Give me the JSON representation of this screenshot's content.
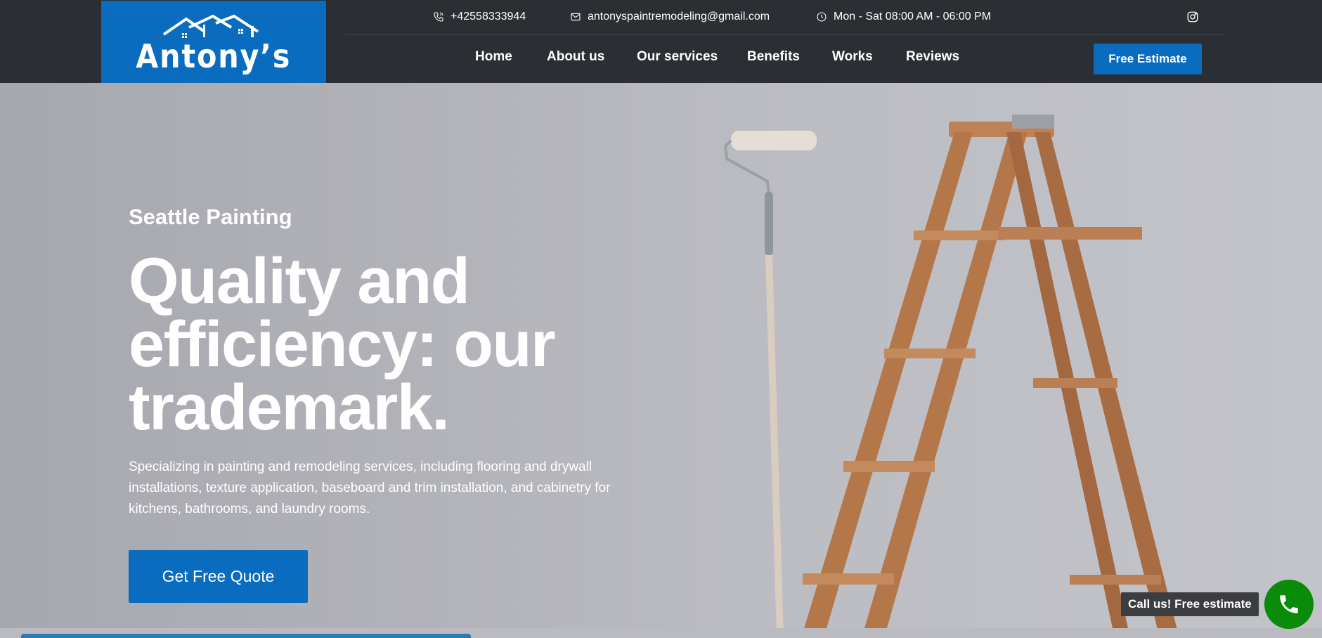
{
  "brand": {
    "name": "Antony’s",
    "color": "#0a6cbf"
  },
  "topbar": {
    "phone": "+42558333944",
    "email": "antonyspaintremodeling@gmail.com",
    "hours": "Mon - Sat 08:00 AM - 06:00 PM",
    "icons": [
      "phone-icon",
      "mail-icon",
      "clock-icon",
      "instagram-icon"
    ]
  },
  "nav": {
    "items": [
      {
        "label": "Home"
      },
      {
        "label": "About us"
      },
      {
        "label": "Our services"
      },
      {
        "label": "Benefits"
      },
      {
        "label": "Works"
      },
      {
        "label": "Reviews"
      }
    ],
    "cta": "Free Estimate"
  },
  "hero": {
    "eyebrow": "Seattle Painting",
    "headline_lines": [
      "Quality and",
      "efficiency: our",
      "trademark."
    ],
    "description": "Specializing in painting and remodeling services, including flooring and drywall installations, texture application, baseboard and trim installation, and cabinetry for kitchens, bathrooms, and laundry rooms.",
    "cta": "Get Free Quote"
  },
  "call_widget": {
    "label": "Call us! Free estimate",
    "color": "#0a8b0a"
  }
}
